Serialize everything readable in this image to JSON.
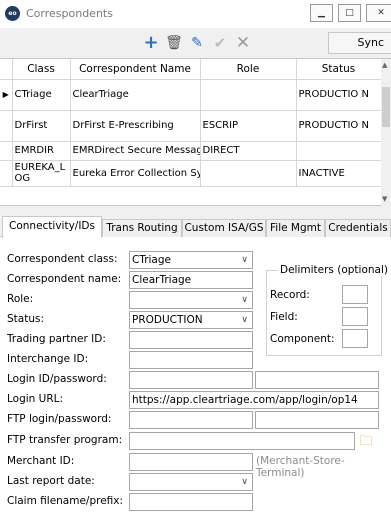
{
  "window": {
    "title": "Correspondents"
  },
  "toolbar": {
    "sync_label": "Sync"
  },
  "table": {
    "columns": [
      "Class",
      "Correspondent Name",
      "Role",
      "Status"
    ],
    "rows": [
      {
        "class": "CTriage",
        "name": "ClearTriage",
        "role": "",
        "status": "PRODUCTIO N",
        "selected": true
      },
      {
        "class": "DrFirst",
        "name": "DrFirst E-Prescribing",
        "role": "ESCRIP",
        "status": "PRODUCTIO N"
      },
      {
        "class": "EMRDIR",
        "name": "EMRDirect Secure Messaging",
        "role": "DIRECT",
        "status": ""
      },
      {
        "class": "EUREKA_L OG",
        "name": "Eureka Error Collection System",
        "role": "",
        "status": "INACTIVE"
      }
    ]
  },
  "tabs": [
    "Connectivity/IDs",
    "Trans Routing",
    "Custom ISA/GS",
    "File Mgmt",
    "Credentials"
  ],
  "form": {
    "correspondent_class_label": "Correspondent class:",
    "correspondent_class_value": "CTriage",
    "correspondent_name_label": "Correspondent name:",
    "correspondent_name_value": "ClearTriage",
    "role_label": "Role:",
    "role_value": "",
    "status_label": "Status:",
    "status_value": "PRODUCTION",
    "trading_partner_label": "Trading partner ID:",
    "trading_partner_value": "",
    "interchange_label": "Interchange ID:",
    "interchange_value": "",
    "login_label": "Login ID/password:",
    "login_id_value": "",
    "login_password_value": "",
    "login_url_label": "Login URL:",
    "login_url_value": "https://app.cleartriage.com/app/login/op14",
    "ftp_login_label": "FTP login/password:",
    "ftp_login_value": "",
    "ftp_password_value": "",
    "ftp_program_label": "FTP transfer program:",
    "ftp_program_value": "",
    "merchant_label": "Merchant ID:",
    "merchant_value": "",
    "merchant_hint": "(Merchant-Store-Terminal)",
    "last_report_label": "Last report date:",
    "last_report_value": "",
    "claim_prefix_label": "Claim filename/prefix:",
    "claim_prefix_value": ""
  },
  "delimiters": {
    "title": "Delimiters (optional)",
    "record_label": "Record:",
    "field_label": "Field:",
    "component_label": "Component:"
  },
  "icons": [
    "app-icon",
    "minimize-icon",
    "maximize-icon",
    "close-icon",
    "add-icon",
    "delete-icon",
    "edit-icon",
    "check-icon",
    "cancel-icon",
    "folder-icon"
  ]
}
